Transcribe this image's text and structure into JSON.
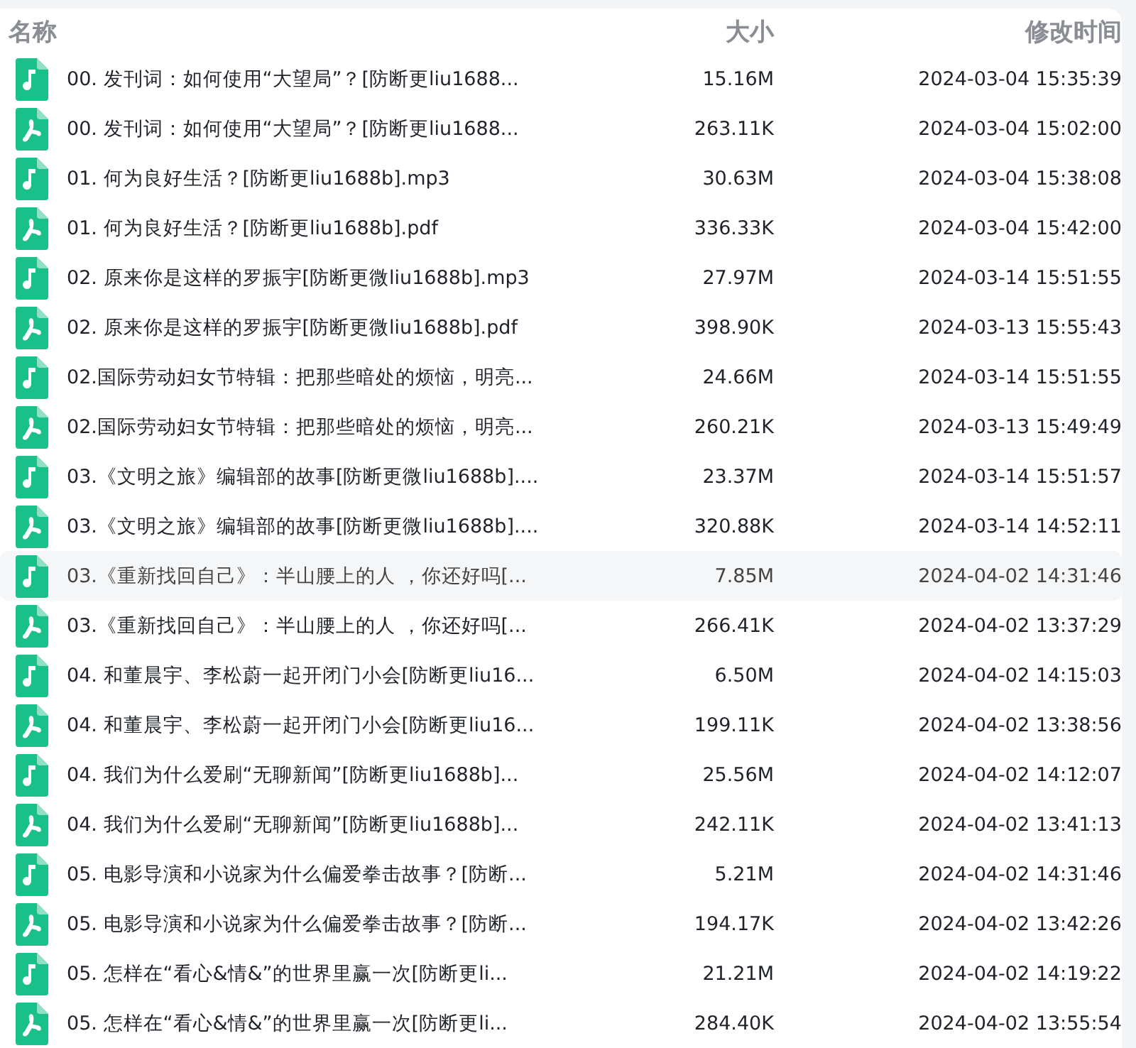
{
  "columns": [
    "名称",
    "大小",
    "修改时间"
  ],
  "rows": [
    {
      "kind": "audio",
      "name": "00. 发刊词：如何使用“大望局”？[防断更liu1688...",
      "size": "15.16M",
      "modified": "2024-03-04 15:35:39",
      "selected": false
    },
    {
      "kind": "pdf",
      "name": "00. 发刊词：如何使用“大望局”？[防断更liu1688...",
      "size": "263.11K",
      "modified": "2024-03-04 15:02:00",
      "selected": false
    },
    {
      "kind": "audio",
      "name": "01. 何为良好生活？[防断更liu1688b].mp3",
      "size": "30.63M",
      "modified": "2024-03-04 15:38:08",
      "selected": false
    },
    {
      "kind": "pdf",
      "name": "01. 何为良好生活？[防断更liu1688b].pdf",
      "size": "336.33K",
      "modified": "2024-03-04 15:42:00",
      "selected": false
    },
    {
      "kind": "audio",
      "name": "02. 原来你是这样的罗振宇[防断更微liu1688b].mp3",
      "size": "27.97M",
      "modified": "2024-03-14 15:51:55",
      "selected": false
    },
    {
      "kind": "pdf",
      "name": "02. 原来你是这样的罗振宇[防断更微liu1688b].pdf",
      "size": "398.90K",
      "modified": "2024-03-13 15:55:43",
      "selected": false
    },
    {
      "kind": "audio",
      "name": "02.国际劳动妇女节特辑：把那些暗处的烦恼，明亮...",
      "size": "24.66M",
      "modified": "2024-03-14 15:51:55",
      "selected": false
    },
    {
      "kind": "pdf",
      "name": "02.国际劳动妇女节特辑：把那些暗处的烦恼，明亮...",
      "size": "260.21K",
      "modified": "2024-03-13 15:49:49",
      "selected": false
    },
    {
      "kind": "audio",
      "name": "03.《文明之旅》编辑部的故事[防断更微liu1688b]....",
      "size": "23.37M",
      "modified": "2024-03-14 15:51:57",
      "selected": false
    },
    {
      "kind": "pdf",
      "name": "03.《文明之旅》编辑部的故事[防断更微liu1688b]....",
      "size": "320.88K",
      "modified": "2024-03-14 14:52:11",
      "selected": false
    },
    {
      "kind": "audio",
      "name": "03.《重新找回自己》：半山腰上的人 ，你还好吗[...",
      "size": "7.85M",
      "modified": "2024-04-02 14:31:46",
      "selected": true
    },
    {
      "kind": "pdf",
      "name": "03.《重新找回自己》：半山腰上的人 ，你还好吗[...",
      "size": "266.41K",
      "modified": "2024-04-02 13:37:29",
      "selected": false
    },
    {
      "kind": "audio",
      "name": "04. 和董晨宇、李松蔚一起开闭门小会[防断更liu16...",
      "size": "6.50M",
      "modified": "2024-04-02 14:15:03",
      "selected": false
    },
    {
      "kind": "pdf",
      "name": "04. 和董晨宇、李松蔚一起开闭门小会[防断更liu16...",
      "size": "199.11K",
      "modified": "2024-04-02 13:38:56",
      "selected": false
    },
    {
      "kind": "audio",
      "name": "04. 我们为什么爱刷“无聊新闻”[防断更liu1688b]...",
      "size": "25.56M",
      "modified": "2024-04-02 14:12:07",
      "selected": false
    },
    {
      "kind": "pdf",
      "name": "04. 我们为什么爱刷“无聊新闻”[防断更liu1688b]...",
      "size": "242.11K",
      "modified": "2024-04-02 13:41:13",
      "selected": false
    },
    {
      "kind": "audio",
      "name": "05. 电影导演和小说家为什么偏爱拳击故事？[防断...",
      "size": "5.21M",
      "modified": "2024-04-02 14:31:46",
      "selected": false
    },
    {
      "kind": "pdf",
      "name": "05. 电影导演和小说家为什么偏爱拳击故事？[防断...",
      "size": "194.17K",
      "modified": "2024-04-02 13:42:26",
      "selected": false
    },
    {
      "kind": "audio",
      "name": "05. 怎样在“看心&情&”的世界里赢一次[防断更li...",
      "size": "21.21M",
      "modified": "2024-04-02 14:19:22",
      "selected": false
    },
    {
      "kind": "pdf",
      "name": "05. 怎样在“看心&情&”的世界里赢一次[防断更li...",
      "size": "284.40K",
      "modified": "2024-04-02 13:55:54",
      "selected": false
    }
  ]
}
